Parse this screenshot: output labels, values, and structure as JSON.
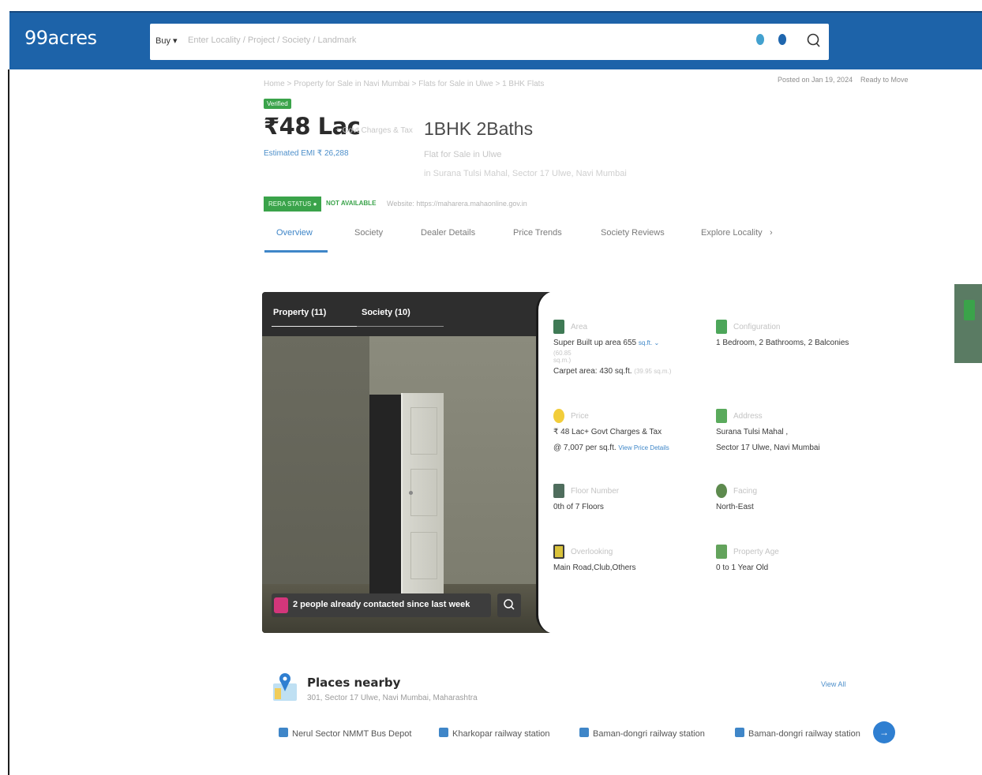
{
  "header": {
    "logo": "99acres",
    "search": {
      "mode": "Buy",
      "placeholder": "Enter Locality / Project / Society / Landmark"
    }
  },
  "listing": {
    "breadcrumb": "Home  >  Property for Sale in Navi Mumbai  >  Flats for Sale in Ulwe  >  1 BHK Flats",
    "posted": "Posted on Jan 19, 2024",
    "status": "Ready to Move",
    "verified_badge": "Verified",
    "price": "₹48 Lac",
    "price_note": "+ Govt Charges & Tax",
    "emi": "Estimated EMI ₹ 26,288",
    "config_title": "1BHK 2Baths",
    "config_sub1": "Flat for Sale in Ulwe",
    "config_sub2": "in Surana Tulsi Mahal, Sector 17 Ulwe, Navi Mumbai",
    "rera_badge": "RERA STATUS",
    "rera_state": "NOT AVAILABLE",
    "rera_website": "Website: https://maharera.mahaonline.gov.in"
  },
  "tabs": [
    {
      "label": "Overview"
    },
    {
      "label": "Society"
    },
    {
      "label": "Dealer Details"
    },
    {
      "label": "Price Trends"
    },
    {
      "label": "Society Reviews"
    },
    {
      "label": "Explore Locality"
    }
  ],
  "tabs_more": "›",
  "gallery": {
    "tab_property": "Property (11)",
    "tab_society": "Society (10)",
    "contact_text": "2 people already contacted since last week"
  },
  "details": {
    "area": {
      "label": "Area",
      "value": "Super Built up area 655",
      "unit": "sq.ft.",
      "small": "(60.85 sq.m.)",
      "carpet": "Carpet area: 430 sq.ft.",
      "carpet_sub": "(39.95 sq.m.)"
    },
    "configuration": {
      "label": "Configuration",
      "value": "1 Bedroom, 2 Bathrooms, 2 Balconies"
    },
    "price": {
      "label": "Price",
      "value": "₹ 48 Lac+ Govt Charges & Tax",
      "per_sqft": "@ 7,007 per sq.ft.",
      "link": "View Price Details"
    },
    "address": {
      "label": "Address",
      "value": "Surana Tulsi Mahal ,",
      "value2": "Sector 17 Ulwe, Navi Mumbai"
    },
    "floor": {
      "label": "Floor Number",
      "value": "0th  of 7 Floors"
    },
    "facing": {
      "label": "Facing",
      "value": "North-East"
    },
    "overlooking": {
      "label": "Overlooking",
      "value": "Main Road,Club,Others"
    },
    "age": {
      "label": "Property Age",
      "value": "0 to 1 Year Old"
    }
  },
  "places": {
    "title": "Places nearby",
    "address": "301, Sector 17 Ulwe, Navi Mumbai, Maharashtra",
    "view_all": "View All",
    "items": [
      {
        "label": "Nerul Sector NMMT Bus Depot"
      },
      {
        "label": "Kharkopar railway station"
      },
      {
        "label": "Baman-dongri railway station"
      },
      {
        "label": "Baman-dongri railway station"
      }
    ],
    "next_label": "→"
  },
  "colors": {
    "header": "#1d63a9",
    "accent": "#3f86c8",
    "green": "#3aa34a",
    "pink": "#d3367b"
  }
}
